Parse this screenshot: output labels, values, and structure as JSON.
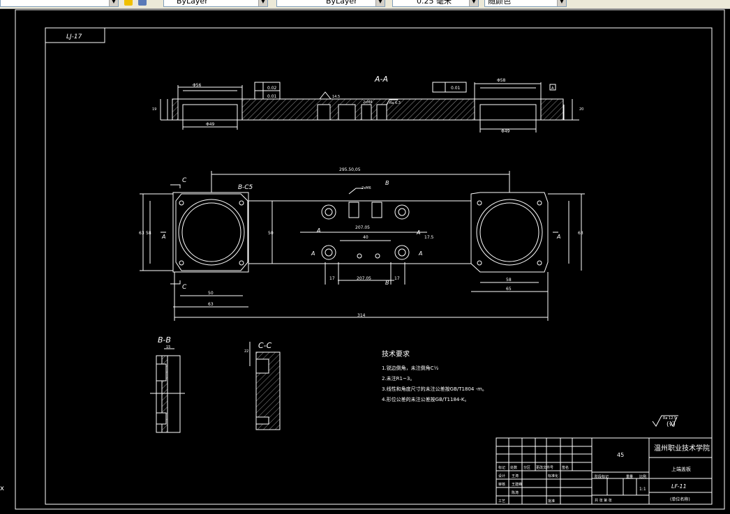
{
  "toolbar": {
    "color_combo": "ByLayer",
    "linetype_combo": "ByLayer",
    "lineweight_combo": "0.25 毫米",
    "plotstyle_combo": "随颜色"
  },
  "drawing": {
    "sheet_code": "LJ-17",
    "section_aa": "A-A",
    "view_bb": "B-B",
    "view_cc": "C-C",
    "label_b_c5": "B-C5",
    "label_a": "A",
    "label_b": "B",
    "label_c": "C",
    "label_a_mark": "A",
    "tolerance_1": "0.02",
    "tolerance_2": "0.01",
    "tolerance_3": "0.01",
    "dims": {
      "d56": "Φ56",
      "d49": "Φ49",
      "d58": "Φ58",
      "d49b": "Φ49",
      "len_total": "295.50,05",
      "w_50": "50",
      "w_63": "63",
      "w_314": "314",
      "w_58": "58",
      "w_65": "65",
      "w_40": "40",
      "h_58": "58",
      "h_63": "63",
      "h_63b": "63",
      "d_2075": "207.05",
      "d_2075b": "207.05",
      "d_17": "17",
      "d_17b": "17",
      "d_175": "17.5",
      "m6": "2xM6",
      "m6b": "2xM6",
      "r63": "Ra 6.3",
      "h_19": "19",
      "h_20": "20",
      "w_15": "15",
      "d_22": "22",
      "d_14": "14.5",
      "w_17b": "17",
      "d_50b": "50"
    },
    "tech_title": "技术要求",
    "tech_notes": [
      "1.锐边倒角，未注倒角C½",
      "2.未注R1~3。",
      "3.线性和角度尺寸的未注公差按GB/T1804 -m。",
      "4.形位公差的未注公差按GB/T1184-K。"
    ],
    "roughness": "Ra 12.5",
    "roughness_paren": "(√)",
    "title_block": {
      "material": "45",
      "school": "温州职业技术学院",
      "part_name": "上端盖板",
      "drawing_no": "LF-11",
      "unit": "(单位名称)",
      "scale": "1:1",
      "row_labels": [
        "标记",
        "设计",
        "审核",
        "工艺"
      ],
      "col_labels": [
        "处数",
        "分区",
        "更改文件号",
        "签名"
      ],
      "stage": "阶段标记",
      "weight": "重量",
      "ratio": "比例",
      "sheets": "共 张 第 张",
      "names": [
        "王涛",
        "王建峰",
        "陈涛"
      ],
      "approve": "批准",
      "std": "标准化",
      "date": "年月日"
    }
  },
  "side_marker": "x"
}
